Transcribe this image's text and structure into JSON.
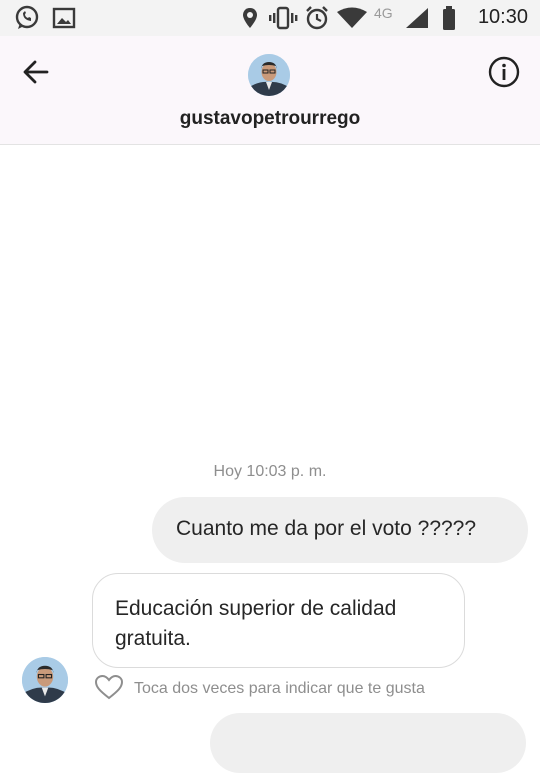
{
  "status_bar": {
    "time": "10:30",
    "network": "4G",
    "left_icons": [
      "whatsapp-icon",
      "gallery-icon"
    ],
    "right_icons": [
      "location-icon",
      "vibrate-icon",
      "alarm-icon",
      "wifi-icon",
      "signal-icon",
      "battery-icon"
    ]
  },
  "header": {
    "username": "gustavopetrourrego",
    "back_icon": "arrow-left-icon",
    "info_icon": "info-icon"
  },
  "thread": {
    "timestamp": "Hoy 10:03 p. m.",
    "messages": [
      {
        "direction": "outgoing",
        "text": "Cuanto me da por el voto ?????"
      },
      {
        "direction": "incoming",
        "text": "Educación superior de calidad gratuita."
      }
    ],
    "like_hint": "Toca dos veces para indicar que te gusta"
  },
  "colors": {
    "header_bg": "#fbf7fb",
    "outgoing_bubble": "#efefef",
    "incoming_border": "#dbdbdb",
    "muted_text": "#8e8e8e"
  }
}
